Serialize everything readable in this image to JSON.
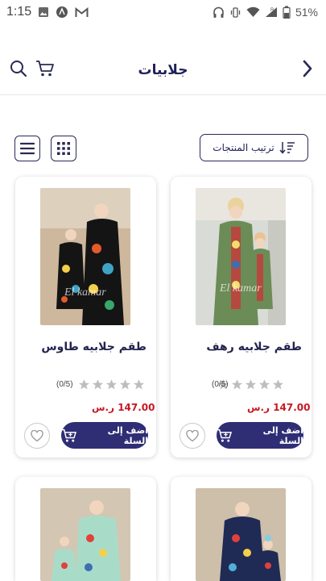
{
  "status": {
    "time": "1:15",
    "battery": "51%"
  },
  "header": {
    "title": "جلابيات"
  },
  "toolbar": {
    "sort_label": "ترتيب المنتجات"
  },
  "products": [
    {
      "name": "طقم جلابيه رهف",
      "rating": "(0/5)",
      "price": "147.00 ر.س",
      "add_label": "أضف إلى السلة",
      "watermark": "El kamar"
    },
    {
      "name": "طقم جلابيه طاوس",
      "rating": "(0/5)",
      "price": "147.00 ر.س",
      "add_label": "أضف إلى السلة",
      "watermark": "El kamar"
    }
  ],
  "colors": {
    "accent": "#2f2d74",
    "price": "#c61a25",
    "text": "#20205a"
  }
}
